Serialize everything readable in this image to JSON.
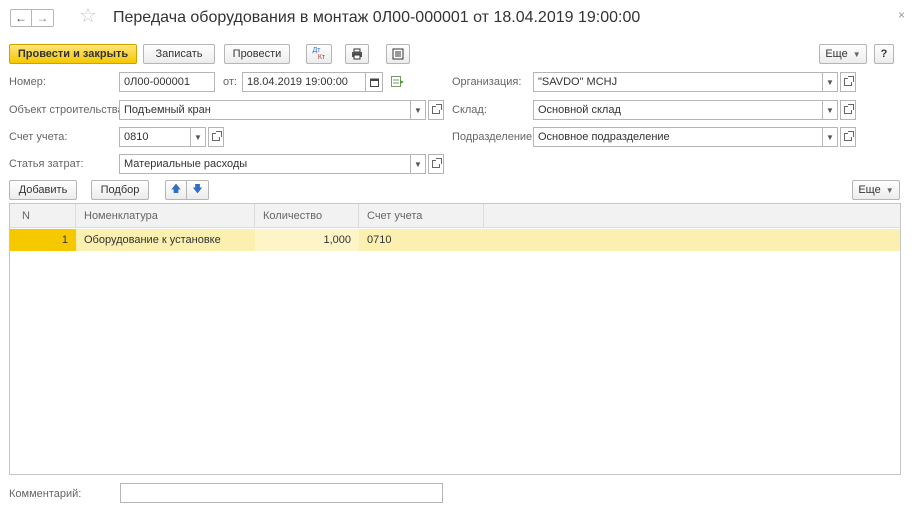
{
  "window": {
    "title": "Передача оборудования в монтаж 0Л00-000001 от 18.04.2019 19:00:00",
    "back_icon": "arrow-left-icon",
    "forward_icon": "arrow-right-icon",
    "favorite_icon": "star-icon",
    "close_label": "×"
  },
  "toolbar": {
    "post_and_close": "Провести и закрыть",
    "save": "Записать",
    "post": "Провести",
    "dt_kt_top": "Дт",
    "dt_kt_bottom": "Кт",
    "more": "Еще",
    "help": "?"
  },
  "form": {
    "number_label": "Номер:",
    "number_value": "0Л00-000001",
    "date_label": "от:",
    "date_value": "18.04.2019 19:00:00",
    "construction_label": "Объект строительства:",
    "construction_value": "Подъемный кран",
    "account_label": "Счет учета:",
    "account_value": "0810",
    "cost_item_label": "Статья затрат:",
    "cost_item_value": "Материальные расходы",
    "org_label": "Организация:",
    "org_value": "\"SAVDO\" MCHJ",
    "warehouse_label": "Склад:",
    "warehouse_value": "Основной склад",
    "department_label": "Подразделение:",
    "department_value": "Основное подразделение",
    "comment_label": "Комментарий:",
    "comment_value": ""
  },
  "table_toolbar": {
    "add": "Добавить",
    "pick": "Подбор",
    "up_icon": "arrow-up-icon",
    "down_icon": "arrow-down-icon",
    "more": "Еще"
  },
  "table": {
    "columns": [
      "N",
      "Номенклатура",
      "Количество",
      "Счет учета"
    ],
    "rows": [
      {
        "n": "1",
        "item": "Оборудование к установке",
        "qty": "1,000",
        "account": "0710"
      }
    ]
  },
  "colors": {
    "primary_button": "#f5c800",
    "selected_row": "#fbf0b0",
    "arrow_blue": "#2f6fc9"
  }
}
